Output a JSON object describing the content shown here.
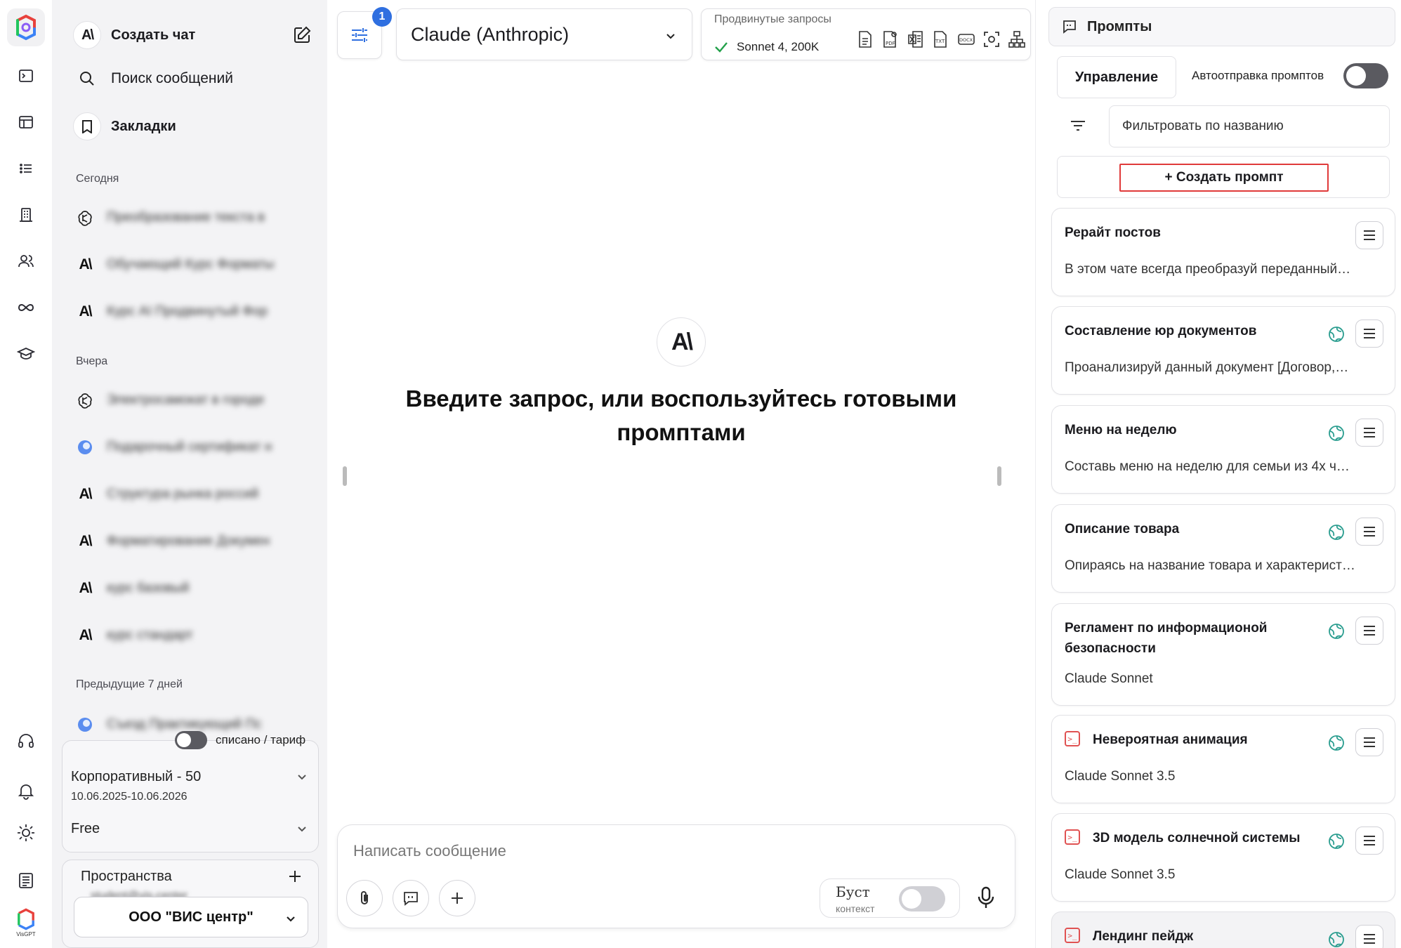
{
  "sidebar": {
    "create_chat": "Создать чат",
    "search": "Поиск сообщений",
    "bookmarks": "Закладки",
    "sections": {
      "today": "Сегодня",
      "yesterday": "Вчера",
      "prev7": "Предыдущие 7 дней"
    },
    "today_chats": [
      {
        "icon": "openai-icon",
        "title": "Преобразование текста в"
      },
      {
        "icon": "anthropic-icon",
        "title": "Обучающий Курс Форматы"
      },
      {
        "icon": "anthropic-icon",
        "title": "Курс AI Продвинутый Фор"
      }
    ],
    "yesterday_chats": [
      {
        "icon": "openai-icon",
        "title": "Электросамокат в городе"
      },
      {
        "icon": "blue-circle-icon",
        "title": "Подарочный сертификат н"
      },
      {
        "icon": "anthropic-icon",
        "title": "Структура рынка россий"
      },
      {
        "icon": "anthropic-icon",
        "title": "Форматирование Докумен"
      },
      {
        "icon": "anthropic-icon",
        "title": "курс базовый"
      },
      {
        "icon": "anthropic-icon",
        "title": "курс стандарт"
      }
    ],
    "prev7_chats": [
      {
        "icon": "blue-circle-icon",
        "title": "Съезд Практикующий Пс"
      }
    ],
    "tariff_toggle_label": "списано / тариф",
    "plan_name": "Корпоративный - 50",
    "plan_dates": "10.06.2025-10.06.2026",
    "plan_tier": "Free",
    "spaces_label": "Пространства",
    "spaces_email": "student@vis-center",
    "org_name": "ООО \"ВИС центр\"",
    "brand_small": "VisGPT"
  },
  "topbar": {
    "settings_badge": "1",
    "model_name": "Claude (Anthropic)",
    "advanced_label": "Продвинутые запросы",
    "advanced_value": "Sonnet 4, 200K"
  },
  "main": {
    "hero_title_line1": "Введите запрос, или воспользуйтесь готовыми",
    "hero_title_line2": "промптами",
    "composer_placeholder": "Написать сообщение",
    "boost_label": "Буст",
    "boost_sub": "контекст"
  },
  "prompts": {
    "header": "Промпты",
    "manage": "Управление",
    "autosend": "Автоотправка промптов",
    "filter_placeholder": "Фильтровать по названию",
    "create": "+ Создать промпт",
    "cards": [
      {
        "title": "Рерайт постов",
        "desc": "В этом чате всегда преобразуй переданный…"
      },
      {
        "title": "Составление юр документов",
        "desc": "Проанализируй данный документ [Договор,…"
      },
      {
        "title": "Меню на неделю",
        "desc": "Составь меню на неделю для семьи из 4х ч…"
      },
      {
        "title": "Описание товара",
        "desc": "Опираясь на название товара и характерист…"
      },
      {
        "title": "Регламент по информационой безопасности",
        "desc": "Claude Sonnet"
      },
      {
        "title": "Невероятная анимация",
        "desc": "Claude Sonnet 3.5"
      },
      {
        "title": "3D модель солнечной системы",
        "desc": "Claude Sonnet 3.5"
      },
      {
        "title": "Лендинг пейдж",
        "desc": ""
      }
    ]
  },
  "colors": {
    "accent_blue": "#2f6fe0",
    "highlight_red": "#e03a3a",
    "globe_teal": "#2a9d8f"
  }
}
